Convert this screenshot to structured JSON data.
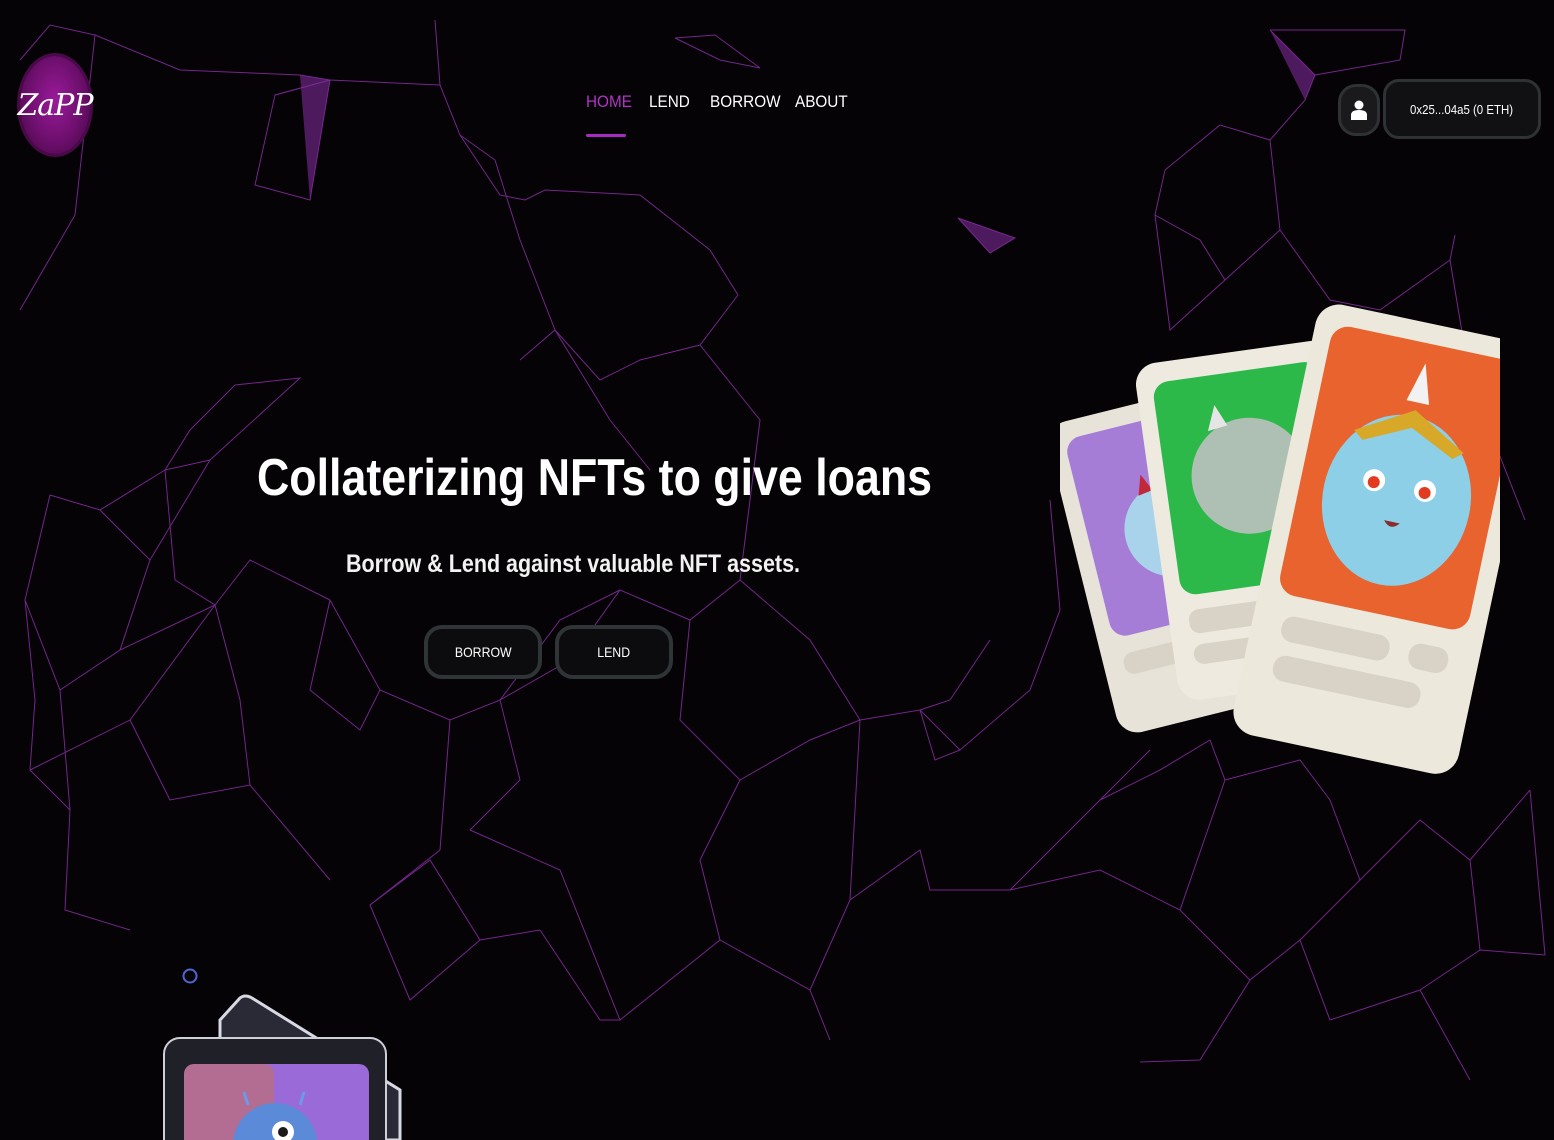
{
  "brand": {
    "logo_text": "ZaPP"
  },
  "nav": {
    "items": [
      {
        "label": "HOME",
        "active": true
      },
      {
        "label": "LEND",
        "active": false
      },
      {
        "label": "BORROW",
        "active": false
      },
      {
        "label": "ABOUT",
        "active": false
      }
    ]
  },
  "header": {
    "user_icon": "user-icon",
    "wallet_label": "0x25...04a5 (0 ETH)"
  },
  "hero": {
    "title": "Collaterizing NFTs to give loans",
    "subtitle": "Borrow & Lend against valuable NFT assets.",
    "buttons": {
      "borrow": "BORROW",
      "lend": "LEND"
    }
  },
  "colors": {
    "accent": "#a62bbf",
    "background": "#050305",
    "mesh": "#8a2aa0",
    "button_border": "#2f3437"
  }
}
